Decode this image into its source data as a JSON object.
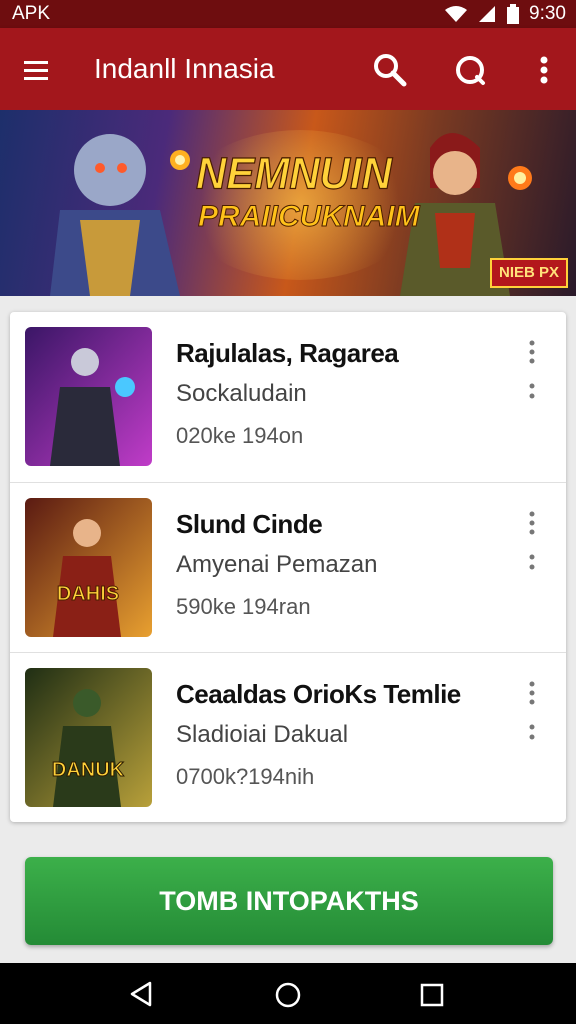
{
  "status_bar": {
    "left_text": "APK",
    "time": "9:30",
    "icons": [
      "wifi-icon",
      "signal-icon",
      "battery-icon"
    ]
  },
  "app_bar": {
    "title": "Indanll Innasia",
    "icons": [
      "menu-icon",
      "search-icon",
      "refresh-icon",
      "more-vert-icon"
    ]
  },
  "banner": {
    "headline": "NEMNUIN",
    "subheadline": "PRAIICUKNAIM",
    "tag": "NIEB PX"
  },
  "list": {
    "items": [
      {
        "title": "Rajulalas, Ragarea",
        "subtitle": "Sockaludain",
        "meta": "020ke 194on",
        "thumb_label": "",
        "thumb_colors": [
          "#4a1d7a",
          "#c03cc8"
        ]
      },
      {
        "title": "Slund Cinde",
        "subtitle": "Amyenai Pemazan",
        "meta": "590ke 194ran",
        "thumb_label": "DAHIS",
        "thumb_colors": [
          "#7a2a16",
          "#e8a030"
        ]
      },
      {
        "title": "Ceaaldas OrioKs Temlie",
        "subtitle": "Sladioiai Dakual",
        "meta": "0700k?194nih",
        "thumb_label": "DANUK",
        "thumb_colors": [
          "#2b3a1c",
          "#b8a03a"
        ]
      }
    ]
  },
  "install_button": {
    "label": "TOMB INTOPAKTHS"
  },
  "colors": {
    "status_bar": "#6e0d0f",
    "app_bar": "#a3171c",
    "install_button": "#2e9e3f"
  }
}
